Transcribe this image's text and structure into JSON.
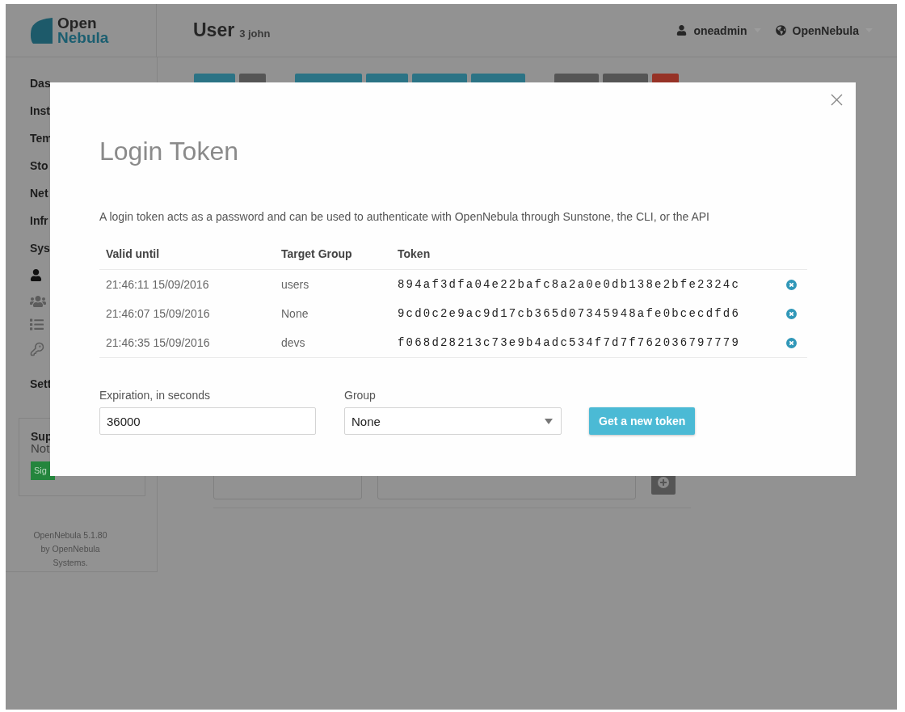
{
  "header": {
    "logo": {
      "line_1": "Open",
      "line_2": "Nebula"
    },
    "title": "User",
    "subtitle": "3 john",
    "user_menu": "oneadmin",
    "zone_menu": "OpenNebula"
  },
  "sidebar": {
    "items": [
      "Das",
      "Inst",
      "Tem",
      "Sto",
      "Net",
      "Infr",
      "Sys"
    ],
    "icons": [
      {
        "selected": true
      },
      {
        "selected": false
      },
      {
        "selected": false
      },
      {
        "selected": false
      }
    ],
    "settings": "Sett",
    "support": {
      "title": "Sup",
      "status": "Not",
      "button": "Sig"
    },
    "footer": "OpenNebula 5.1.80 by OpenNebula Systems."
  },
  "toolbar": [
    [
      {
        "color": "#2b7385"
      },
      {
        "color": "#555555"
      }
    ],
    [
      {
        "color": "#2b7385"
      },
      {
        "color": "#2b7385"
      },
      {
        "color": "#2b7385"
      },
      {
        "color": "#2b7385"
      }
    ],
    [
      {
        "color": "#555555"
      },
      {
        "color": "#555555"
      },
      {
        "color": "#963226"
      }
    ]
  ],
  "modal": {
    "title": "Login Token",
    "description": "A login token acts as a password and can be used to authenticate with OpenNebula through Sunstone, the CLI, or the API",
    "columns": [
      "Valid until",
      "Target Group",
      "Token"
    ],
    "rows": [
      {
        "valid_until": "21:46:11 15/09/2016",
        "group": "users",
        "token": "894af3dfa04e22bafc8a2a0e0db138e2bfe2324c"
      },
      {
        "valid_until": "21:46:07 15/09/2016",
        "group": "None",
        "token": "9cd0c2e9ac9d17cb365d07345948afe0bcecdfd6"
      },
      {
        "valid_until": "21:46:35 15/09/2016",
        "group": "devs",
        "token": "f068d28213c73e9b4adc534f7d7f762036797779"
      }
    ],
    "expiration": {
      "label": "Expiration, in seconds",
      "value": "36000"
    },
    "group": {
      "label": "Group",
      "value": "None"
    },
    "submit": "Get a new token"
  }
}
